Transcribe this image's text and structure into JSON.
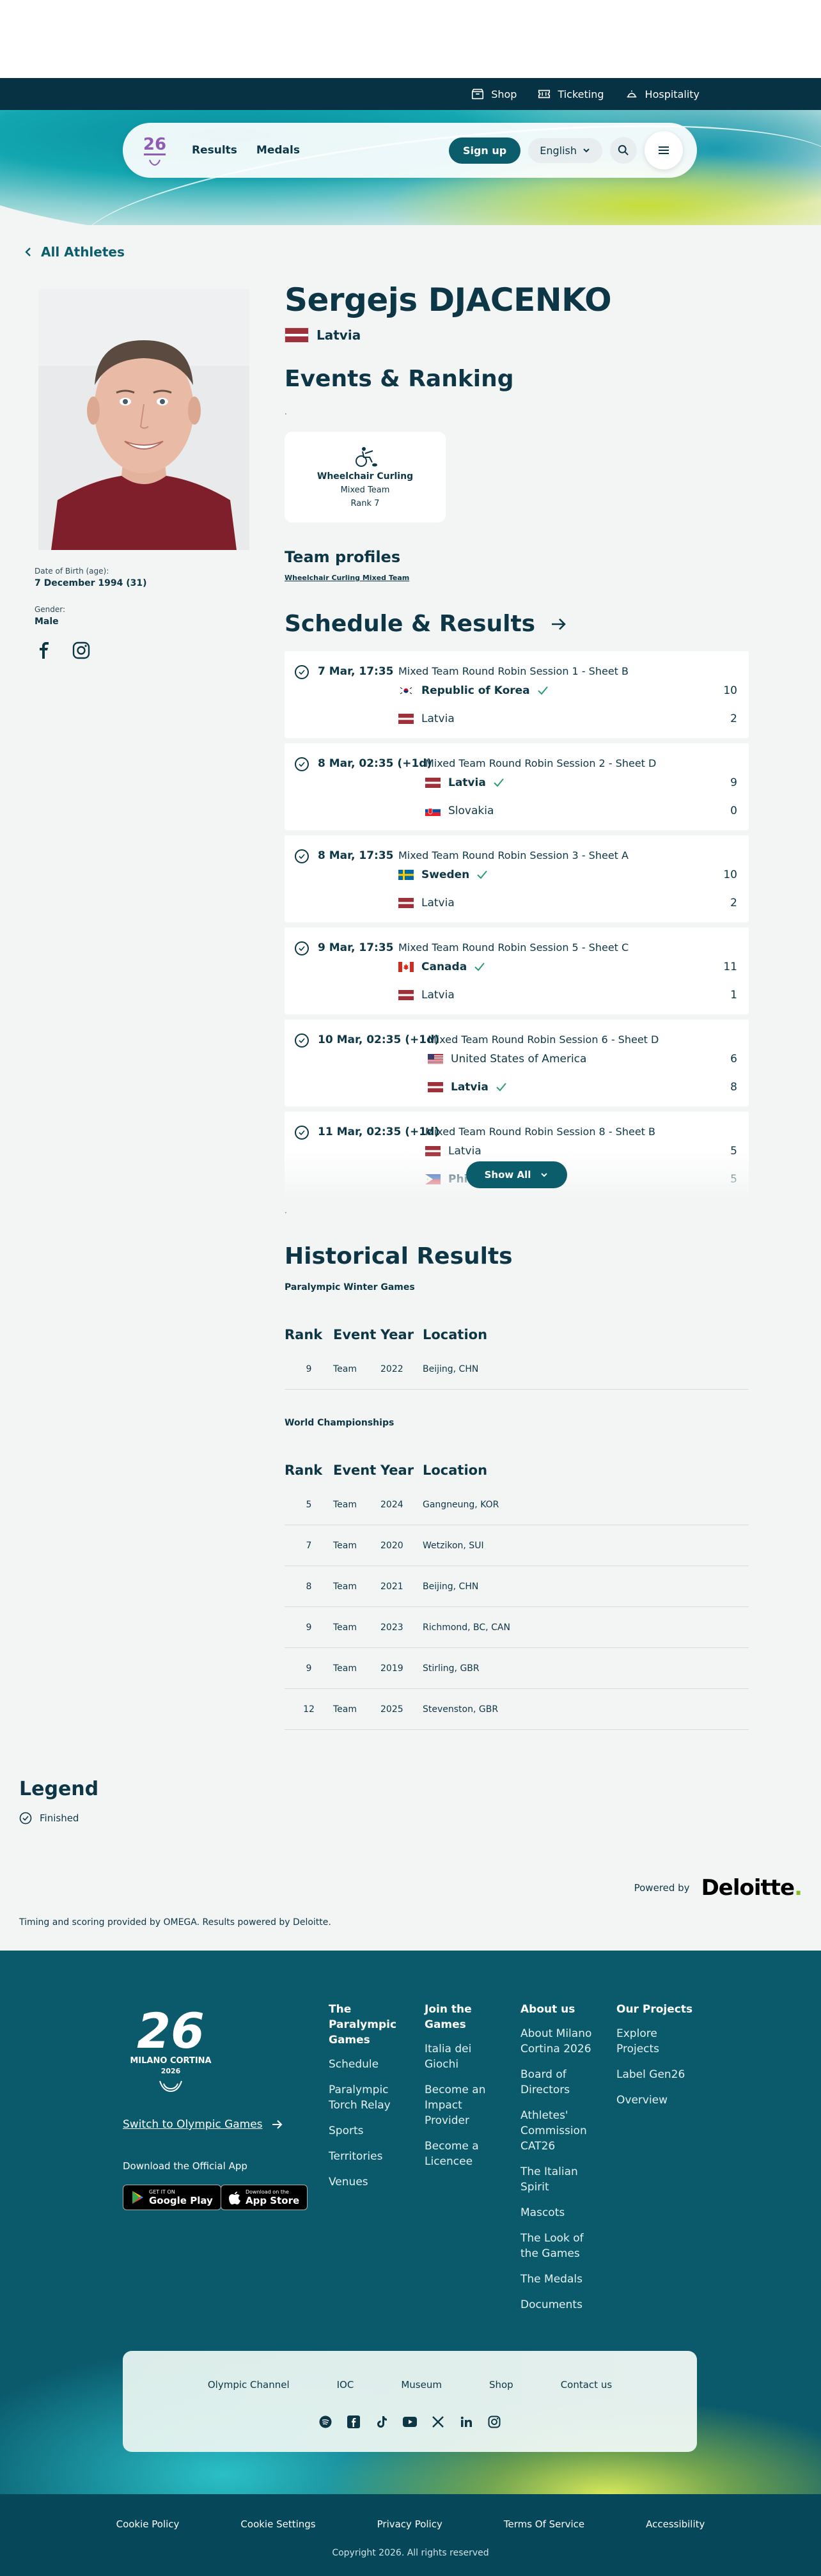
{
  "util_bar": {
    "shop": "Shop",
    "ticketing": "Ticketing",
    "hospitality": "Hospitality"
  },
  "nav": {
    "results": "Results",
    "medals": "Medals",
    "sign_up": "Sign up",
    "language": "English"
  },
  "back_link": "All Athletes",
  "athlete": {
    "name": "Sergejs DJACENKO",
    "country": "Latvia",
    "dob_label": "Date of Birth (age):",
    "dob_value": "7 December 1994 (31)",
    "gender_label": "Gender:",
    "gender_value": "Male"
  },
  "events_ranking": {
    "heading": "Events & Ranking",
    "dot": ".",
    "card": {
      "sport": "Wheelchair Curling",
      "event": "Mixed Team",
      "rank": "Rank 7"
    }
  },
  "team_profiles": {
    "heading": "Team profiles",
    "link": "Wheelchair Curling Mixed Team"
  },
  "schedule": {
    "heading": "Schedule & Results",
    "show_all": "Show All",
    "after_dot": ".",
    "rows": [
      {
        "date": "7 Mar, 17:35",
        "title": "Mixed Team Round Robin Session 1 - Sheet B",
        "team1": "Republic of Korea",
        "score1": "10",
        "team2": "Latvia",
        "score2": "2",
        "winner": 1
      },
      {
        "date": "8 Mar, 02:35 (+1d)",
        "title": "Mixed Team Round Robin Session 2 - Sheet D",
        "team1": "Latvia",
        "score1": "9",
        "team2": "Slovakia",
        "score2": "0",
        "winner": 1
      },
      {
        "date": "8 Mar, 17:35",
        "title": "Mixed Team Round Robin Session 3 - Sheet A",
        "team1": "Sweden",
        "score1": "10",
        "team2": "Latvia",
        "score2": "2",
        "winner": 1
      },
      {
        "date": "9 Mar, 17:35",
        "title": "Mixed Team Round Robin Session 5 - Sheet C",
        "team1": "Canada",
        "score1": "11",
        "team2": "Latvia",
        "score2": "1",
        "winner": 1
      },
      {
        "date": "10 Mar, 02:35 (+1d)",
        "title": "Mixed Team Round Robin Session 6 - Sheet D",
        "team1": "United States of America",
        "score1": "6",
        "team2": "Latvia",
        "score2": "8",
        "winner": 2
      },
      {
        "date": "11 Mar, 02:35 (+1d)",
        "title": "Mixed Team Round Robin Session 8 - Sheet B",
        "team1": "Latvia",
        "score1": "5",
        "team2": "Philippines",
        "score2": "5",
        "winner": 2
      }
    ]
  },
  "historical": {
    "heading": "Historical Results",
    "headers": {
      "rank": "Rank",
      "event": "Event",
      "year": "Year",
      "location": "Location"
    },
    "paralympic": {
      "title": "Paralympic Winter Games",
      "rows": [
        {
          "rank": "9",
          "event": "Team",
          "year": "2022",
          "location": "Beijing, CHN"
        }
      ]
    },
    "worlds": {
      "title": "World Championships",
      "rows": [
        {
          "rank": "5",
          "event": "Team",
          "year": "2024",
          "location": "Gangneung, KOR"
        },
        {
          "rank": "7",
          "event": "Team",
          "year": "2020",
          "location": "Wetzikon, SUI"
        },
        {
          "rank": "8",
          "event": "Team",
          "year": "2021",
          "location": "Beijing, CHN"
        },
        {
          "rank": "9",
          "event": "Team",
          "year": "2023",
          "location": "Richmond, BC, CAN"
        },
        {
          "rank": "9",
          "event": "Team",
          "year": "2019",
          "location": "Stirling, GBR"
        },
        {
          "rank": "12",
          "event": "Team",
          "year": "2025",
          "location": "Stevenston, GBR"
        }
      ]
    }
  },
  "legend": {
    "title": "Legend",
    "finished": "Finished"
  },
  "powered": {
    "label": "Powered by",
    "brand": "Deloitte",
    "brand_dot": ".",
    "timing": "Timing and scoring provided by OMEGA. Results powered by Deloitte."
  },
  "footer": {
    "logo_text": "MILANO CORTINA",
    "logo_year": "2026",
    "switch": "Switch to Olympic Games",
    "download": "Download the Official App",
    "google_small": "GET IT ON",
    "google": "Google Play",
    "apple_small": "Download on the",
    "apple": "App Store",
    "columns": [
      {
        "heading": "The Paralympic Games",
        "items": [
          "Schedule",
          "Paralympic Torch Relay",
          "Sports",
          "Territories",
          "Venues"
        ]
      },
      {
        "heading": "Join the Games",
        "items": [
          "Italia dei Giochi",
          "Become an Impact Provider",
          "Become a Licencee"
        ]
      },
      {
        "heading": "About us",
        "items": [
          "About Milano Cortina 2026",
          "Board of Directors",
          "Athletes' Commission CAT26",
          "The Italian Spirit",
          "Mascots",
          "The Look of the Games",
          "The Medals",
          "Documents"
        ]
      },
      {
        "heading": "Our Projects",
        "items": [
          "Explore Projects",
          "Label Gen26",
          "Overview"
        ]
      }
    ],
    "glass_links": [
      "Olympic Channel",
      "IOC",
      "Museum",
      "Shop",
      "Contact us"
    ],
    "legal": [
      "Cookie Policy",
      "Cookie Settings",
      "Privacy Policy",
      "Terms Of Service",
      "Accessibility"
    ],
    "copyright": "Copyright 2026. All rights reserved"
  },
  "colors": {
    "primary": "#0d3646",
    "accent": "#0b5d6c",
    "footer": "#0a5a6c",
    "latvia_red": "#9e3039",
    "win_check": "#2a9d6e"
  }
}
